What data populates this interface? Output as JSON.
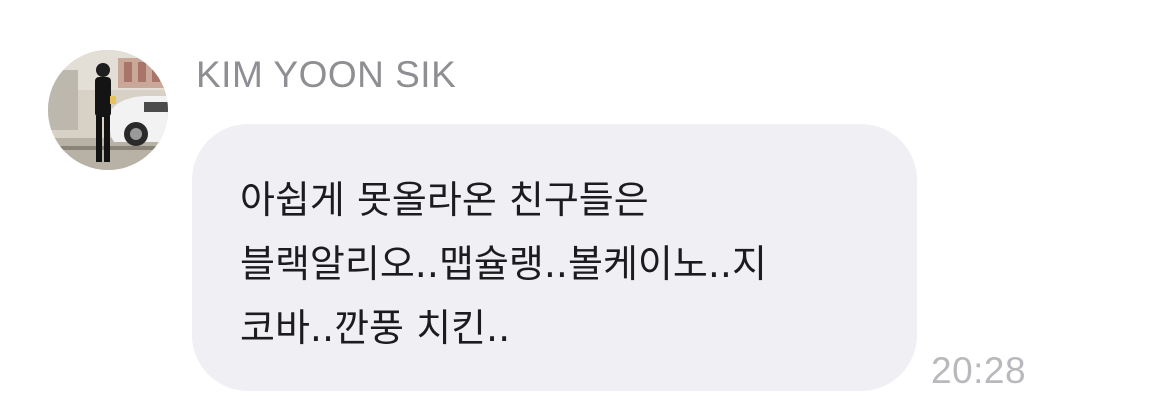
{
  "message": {
    "sender_name": "KIM YOON SIK",
    "avatar_icon": "profile-photo",
    "lines": [
      "아쉽게 못올라온 친구들은",
      "블랙알리오..맵슐랭..볼케이노..지",
      "코바..깐풍 치킨.."
    ],
    "timestamp": "20:28"
  },
  "colors": {
    "bubble_background": "#efeff4",
    "sender_name": "#8e8e93",
    "message_text": "#1c1c1e",
    "timestamp": "#b9b9bd"
  }
}
